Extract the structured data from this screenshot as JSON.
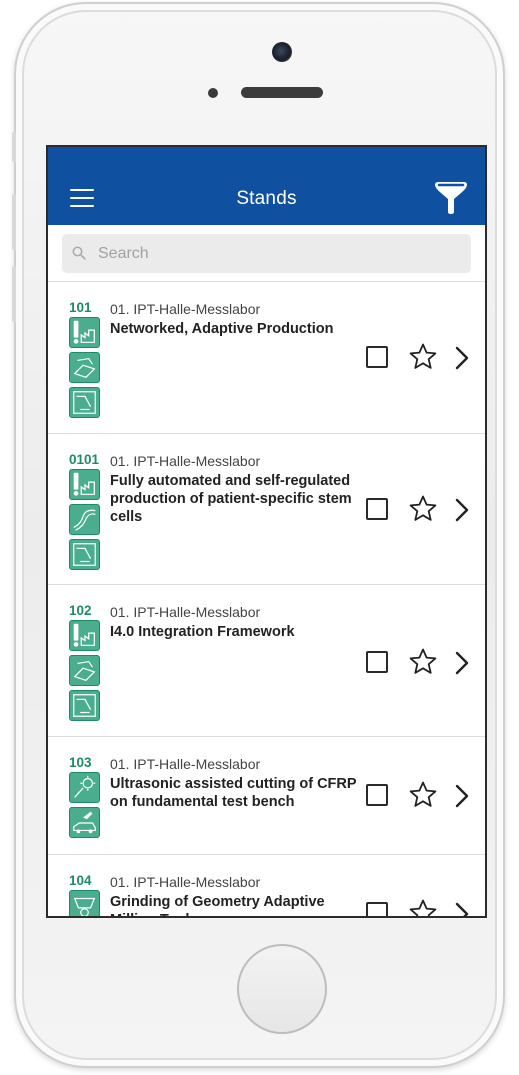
{
  "header": {
    "title": "Stands",
    "menu_icon": "hamburger-menu-icon",
    "filter_icon": "filter-funnel-icon"
  },
  "search": {
    "placeholder": "Search",
    "value": ""
  },
  "colors": {
    "navbar": "#0f51a0",
    "stand_number": "#1e8a67",
    "icon_fill": "#4aae8e"
  },
  "stands": [
    {
      "number": "101",
      "category": "01. IPT-Halle-Messlabor",
      "title": "Networked, Adaptive Production",
      "icons": [
        "industry-4-0-icon",
        "digital-process-icon",
        "machine-tool-icon"
      ],
      "checked": false,
      "favorite": false
    },
    {
      "number": "0101",
      "category": "01. IPT-Halle-Messlabor",
      "title": "Fully automated and self-regulated production of patient-specific stem cells",
      "icons": [
        "industry-4-0-icon",
        "bio-process-icon",
        "machine-tool-icon"
      ],
      "checked": false,
      "favorite": false
    },
    {
      "number": "102",
      "category": "01. IPT-Halle-Messlabor",
      "title": "I4.0 Integration Framework",
      "icons": [
        "industry-4-0-icon",
        "digital-process-icon",
        "machine-tool-icon"
      ],
      "checked": false,
      "favorite": false
    },
    {
      "number": "103",
      "category": "01. IPT-Halle-Messlabor",
      "title": "Ultrasonic assisted cutting of CFRP on fundamental test bench",
      "icons": [
        "gear-process-icon",
        "aerospace-automotive-icon"
      ],
      "checked": false,
      "favorite": false
    },
    {
      "number": "104",
      "category": "01. IPT-Halle-Messlabor",
      "title": "Grinding of Geometry Adaptive Milling Tools",
      "icons": [
        "grinding-process-icon"
      ],
      "checked": false,
      "favorite": false
    }
  ]
}
